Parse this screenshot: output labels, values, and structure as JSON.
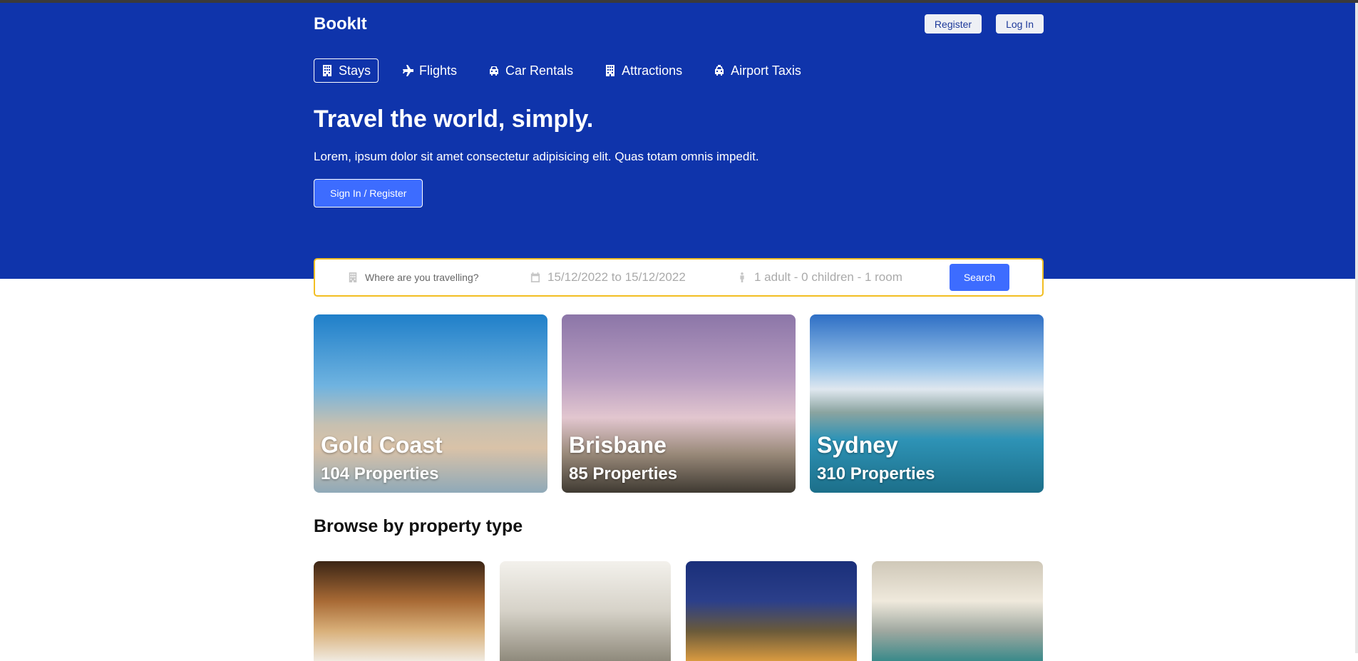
{
  "header": {
    "logo": "BookIt",
    "register": "Register",
    "login": "Log In"
  },
  "nav": [
    {
      "label": "Stays",
      "icon": "building-icon",
      "active": true
    },
    {
      "label": "Flights",
      "icon": "plane-icon"
    },
    {
      "label": "Car Rentals",
      "icon": "car-icon"
    },
    {
      "label": "Attractions",
      "icon": "building-icon"
    },
    {
      "label": "Airport Taxis",
      "icon": "taxi-icon"
    }
  ],
  "hero": {
    "title": "Travel the world, simply.",
    "subtitle": "Lorem, ipsum dolor sit amet consectetur adipisicing elit. Quas totam omnis impedit.",
    "cta": "Sign In / Register"
  },
  "search": {
    "destination_placeholder": "Where are you travelling?",
    "dates": "15/12/2022 to 15/12/2022",
    "guests": "1 adult - 0 children - 1 room",
    "button": "Search"
  },
  "cities": [
    {
      "name": "Gold Coast",
      "properties": "104 Properties"
    },
    {
      "name": "Brisbane",
      "properties": "85 Properties"
    },
    {
      "name": "Sydney",
      "properties": "310 Properties"
    }
  ],
  "browse": {
    "title": "Browse by property type"
  },
  "colors": {
    "hero": "#0f34ab",
    "accent": "#3d6cff",
    "search_border": "#f2be22"
  }
}
